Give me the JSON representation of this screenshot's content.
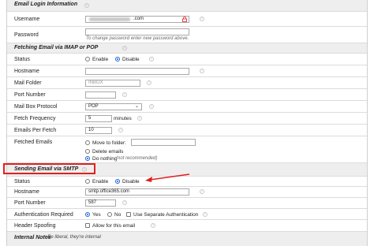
{
  "sections": {
    "login": "Email Login Information",
    "fetching": "Fetching Email via IMAP or POP",
    "sending": "Sending Email via SMTP",
    "internal_label": "Internal Notes",
    "internal_hint": ": Be liberal, they're internal"
  },
  "login": {
    "username_label": "Username",
    "username_suffix": ".com",
    "password_label": "Password",
    "password_hint": "To change password enter new password above."
  },
  "fetch": {
    "status_label": "Status",
    "enable": "Enable",
    "disable": "Disable",
    "hostname_label": "Hostname",
    "mail_folder_label": "Mail Folder",
    "mail_folder_placeholder": "INBOX",
    "port_label": "Port Number",
    "protocol_label": "Mail Box Protocol",
    "protocol_value": "POP",
    "frequency_label": "Fetch Frequency",
    "frequency_value": "5",
    "frequency_unit": "minutes",
    "per_fetch_label": "Emails Per Fetch",
    "per_fetch_value": "10",
    "fetched_label": "Fetched Emails",
    "move_to": "Move to folder:",
    "delete": "Delete emails",
    "do_nothing": "Do nothing",
    "do_nothing_note": "(not recommended)"
  },
  "smtp": {
    "status_label": "Status",
    "enable": "Enable",
    "disable": "Disable",
    "hostname_label": "Hostname",
    "hostname_value": "smtp.office365.com",
    "port_label": "Port Number",
    "port_value": "587",
    "auth_label": "Authentication Required",
    "yes": "Yes",
    "no": "No",
    "separate_auth": "Use Separate Authentication",
    "spoof_label": "Header Spoofing",
    "spoof_option": "Allow for this email"
  },
  "colors": {
    "highlight": "#e02020",
    "radio_on": "#1a66d6"
  }
}
